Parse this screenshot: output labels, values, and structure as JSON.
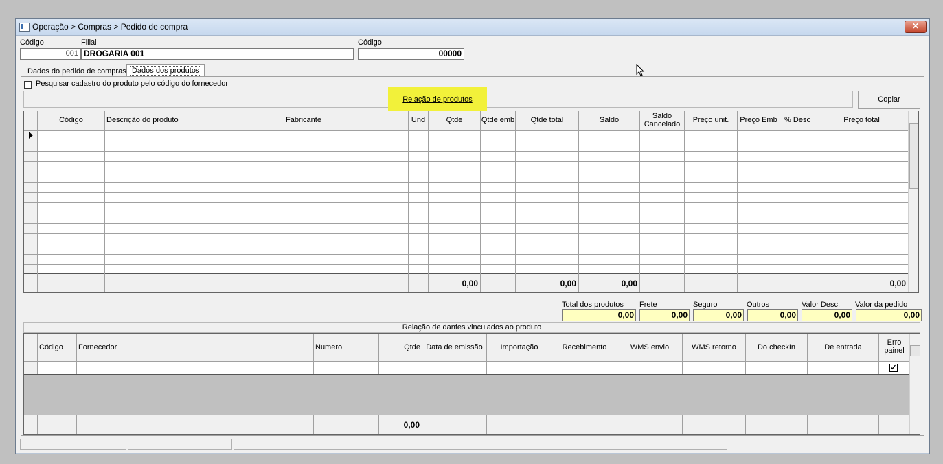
{
  "window": {
    "title": "Operação > Compras > Pedido de compra",
    "close_label": "✕"
  },
  "header": {
    "codigo_label": "Código",
    "codigo_value": "001",
    "filial_label": "Filial",
    "filial_value": "DROGARIA 001",
    "codigo2_label": "Código",
    "codigo2_value": "00000"
  },
  "tabs": [
    {
      "label": "Dados do pedido de compras"
    },
    {
      "label": "Dados dos produtos"
    }
  ],
  "search_option": {
    "label": "Pesquisar cadastro do produto pelo código do fornecedor",
    "checked": false
  },
  "relacao_label": "Relação de produtos",
  "copy_button": "Copiar",
  "products_grid": {
    "columns": [
      "Código",
      "Descrição do produto",
      "Fabricante",
      "Und",
      "Qtde",
      "Qtde emb",
      "Qtde total",
      "Saldo",
      "Saldo Cancelado",
      "Preço unit.",
      "Preço Emb",
      "% Desc",
      "Preço total"
    ],
    "totals": {
      "qtde": "0,00",
      "qtde_total": "0,00",
      "saldo": "0,00",
      "preco_total": "0,00"
    }
  },
  "summary": {
    "total_produtos_label": "Total dos produtos",
    "total_produtos": "0,00",
    "frete_label": "Frete",
    "frete": "0,00",
    "seguro_label": "Seguro",
    "seguro": "0,00",
    "outros_label": "Outros",
    "outros": "0,00",
    "valor_desc_label": "Valor Desc.",
    "valor_desc": "0,00",
    "valor_pedido_label": "Valor da pedido",
    "valor_pedido": "0,00"
  },
  "danfes_grid": {
    "title": "Relação de danfes vinculados ao produto",
    "columns": [
      "Código",
      "Fornecedor",
      "Numero",
      "Qtde",
      "Data de emissão",
      "Importação",
      "Recebimento",
      "WMS envio",
      "WMS retorno",
      "Do checkIn",
      "De entrada",
      "Erro painel"
    ],
    "erro_painel_checked": true,
    "total_qtde": "0,00"
  },
  "colors": {
    "highlight": "#f2f13a",
    "sum_field": "#ffffc0"
  },
  "icons": [
    "window-icon",
    "close-icon",
    "row-indicator-icon",
    "checkbox-icon",
    "mouse-cursor-icon"
  ]
}
